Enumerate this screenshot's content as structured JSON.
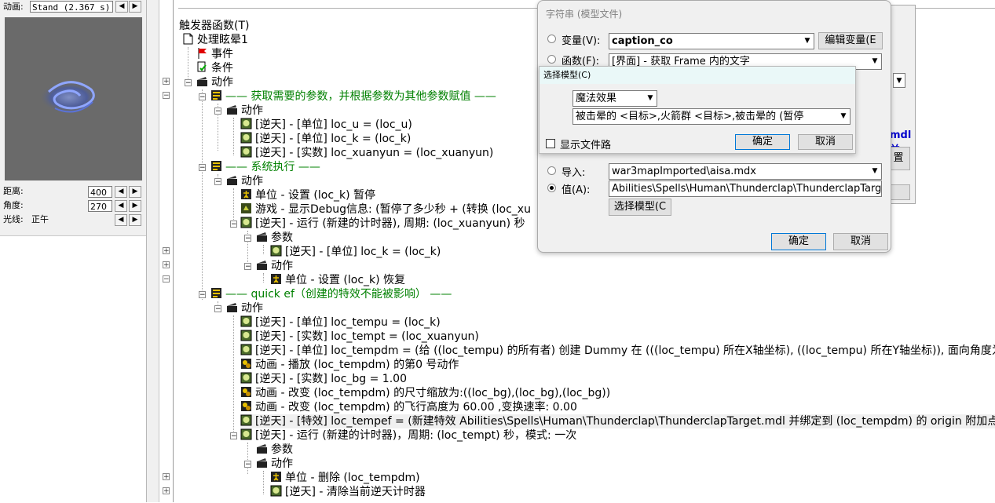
{
  "left_panel": {
    "animation_label": "动画:",
    "animation_value": "Stand (2.367 s)",
    "distance_label": "距离:",
    "distance_value": "400",
    "angle_label": "角度:",
    "angle_value": "270",
    "light_label": "光线:",
    "light_value": "正午",
    "spin_left": "◀",
    "spin_right": "▶"
  },
  "tree": {
    "section_label": "触发器函数(T)",
    "root": "处理眩晕1",
    "event": "事件",
    "condition": "条件",
    "action": "动作",
    "g1_comment": "—— 获取需要的参数，并根据参数为其他参数赋值 ——",
    "g1_actions": "动作",
    "g1_a1": "[逆天] - [单位] loc_u = (loc_u)",
    "g1_a2": "[逆天] - [单位] loc_k = (loc_k)",
    "g1_a3": "[逆天] - [实数] loc_xuanyun = (loc_xuanyun)",
    "g2_comment": "—— 系统执行 ——",
    "g2_actions": "动作",
    "g2_a1": "单位 - 设置 (loc_k) 暂停",
    "g2_a2": "游戏 - 显示Debug信息: (暂停了多少秒 + (转换 (loc_xu",
    "g2_a3": "[逆天] - 运行 (新建的计时器), 周期: (loc_xuanyun) 秒",
    "g2_params": "参数",
    "g2_p1": "[逆天] - [单位] loc_k = (loc_k)",
    "g2_actions2": "动作",
    "g2_b1": "单位 - 设置 (loc_k) 恢复",
    "g3_comment": "—— quick ef（创建的特效不能被影响） ——",
    "g3_actions": "动作",
    "g3_a1": "[逆天] - [单位] loc_tempu = (loc_k)",
    "g3_a2": "[逆天] - [实数] loc_tempt = (loc_xuanyun)",
    "g3_a3": "[逆天] - [单位] loc_tempdm = (给 ((loc_tempu) 的所有者) 创建 Dummy 在 (((loc_tempu) 所在X轴坐标), ((loc_tempu) 所在Y轴坐标)), 面向角度为",
    "g3_a4": "动画 - 播放 (loc_tempdm) 的第0 号动作",
    "g3_a5": "[逆天] - [实数] loc_bg = 1.00",
    "g3_a6": "动画 - 改变 (loc_tempdm) 的尺寸缩放为:((loc_bg),(loc_bg),(loc_bg))",
    "g3_a7": "动画 - 改变 (loc_tempdm) 的飞行高度为 60.00 ,变换速率: 0.00",
    "g3_a8": "[逆天] - [特效] loc_tempef = (新建特效 Abilities\\Spells\\Human\\Thunderclap\\ThunderclapTarget.mdl 并绑定到 (loc_tempdm) 的 origin 附加点上)",
    "g3_a9": "[逆天] - 运行 (新建的计时器)，周期: (loc_tempt) 秒，模式: 一次",
    "g3_params": "参数",
    "g3_actions2": "动作",
    "g3_b1": "单位 - 删除 (loc_tempdm)",
    "g3_b2": "[逆天] - 清除当前逆天计时器"
  },
  "dialog_string": {
    "title": "字符串 (模型文件)",
    "variable_label": "变量(V):",
    "variable_value": "caption_co",
    "edit_variable_button": "编辑变量(E",
    "function_label": "函数(F):",
    "function_value": "[界面] - 获取 Frame 内的文字",
    "import_label": "导入:",
    "import_value": "war3mapImported\\aisa.mdx",
    "value_label": "值(A):",
    "value_text": "Abilities\\Spells\\Human\\Thunderclap\\ThunderclapTarg",
    "choose_model_button": "选择模型(C",
    "ok_button": "确定",
    "cancel_button": "取消",
    "partial_text": "mdl 并",
    "partial_button": "置"
  },
  "dialog_model": {
    "title": "选择模型(C)",
    "category_value": "魔法效果",
    "model_value": "被击晕的 <目标>,火箭群 <目标>,被击晕的 (暂停",
    "show_files_label": "显示文件路",
    "ok_button": "确定",
    "cancel_button": "取消"
  },
  "colors": {
    "comment_green": "#008000",
    "link_blue": "#0000cc"
  }
}
